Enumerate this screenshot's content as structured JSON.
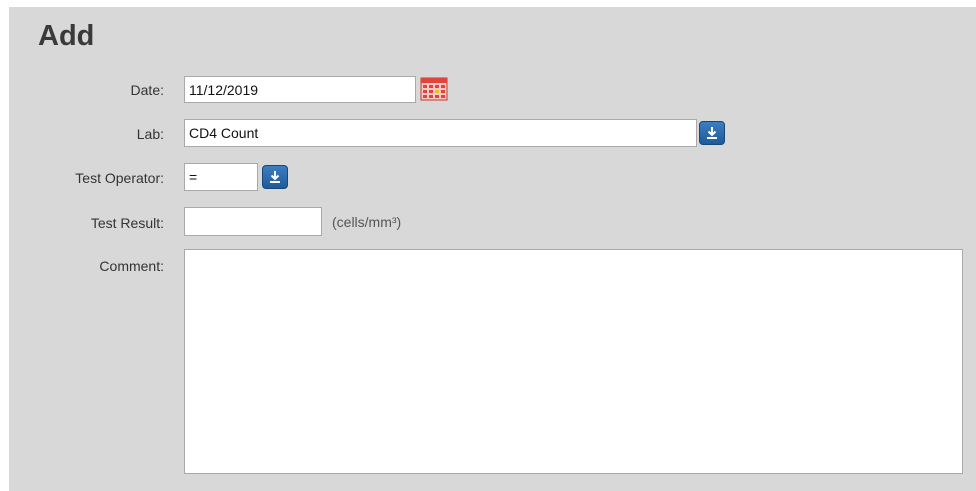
{
  "form": {
    "title": "Add",
    "date": {
      "label": "Date:",
      "value": "11/12/2019"
    },
    "lab": {
      "label": "Lab:",
      "value": "CD4 Count"
    },
    "test_operator": {
      "label": "Test Operator:",
      "value": "="
    },
    "test_result": {
      "label": "Test Result:",
      "value": "",
      "unit": "(cells/mm³)"
    },
    "comment": {
      "label": "Comment:",
      "value": ""
    }
  },
  "icons": {
    "date_picker": "calendar-icon",
    "lab_dropdown": "download-arrow-icon",
    "operator_dropdown": "download-arrow-icon"
  },
  "colors": {
    "panel_bg": "#d8d8d8",
    "button_blue": "#2b6bb0",
    "calendar_red": "#e0443a"
  }
}
